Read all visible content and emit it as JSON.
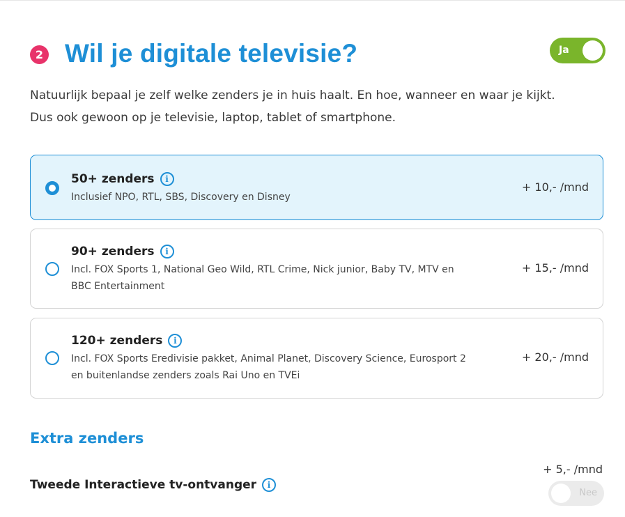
{
  "header": {
    "step": "2",
    "title": "Wil je digitale televisie?",
    "toggle_label": "Ja",
    "toggle_on": true
  },
  "description": {
    "line1": "Natuurlijk bepaal je zelf welke zenders je in huis haalt. En hoe, wanneer en waar je kijkt.",
    "line2": "Dus ook gewoon op je televisie, laptop, tablet of smartphone."
  },
  "options": [
    {
      "title": "50+ zenders",
      "desc": "Inclusief NPO, RTL, SBS, Discovery en Disney",
      "price": "+ 10,- /mnd",
      "selected": true
    },
    {
      "title": "90+ zenders",
      "desc": "Incl. FOX Sports 1, National Geo Wild, RTL Crime, Nick junior, Baby TV, MTV en BBC Entertainment",
      "price": "+ 15,- /mnd",
      "selected": false
    },
    {
      "title": "120+ zenders",
      "desc": "Incl. FOX Sports Eredivisie pakket, Animal Planet, Discovery Science, Eurosport 2 en buitenlandse zenders zoals Rai Uno en TVEi",
      "price": "+ 20,- /mnd",
      "selected": false
    }
  ],
  "extra": {
    "section_title": "Extra zenders",
    "item_label": "Tweede Interactieve tv-ontvanger",
    "item_price": "+ 5,- /mnd",
    "toggle_label": "Nee",
    "toggle_on": false
  },
  "info_glyph": "i",
  "colors": {
    "accent": "#1e8fd6",
    "badge": "#e8336a",
    "toggle_on": "#7ab52b",
    "selected_bg": "#e3f4fc"
  }
}
